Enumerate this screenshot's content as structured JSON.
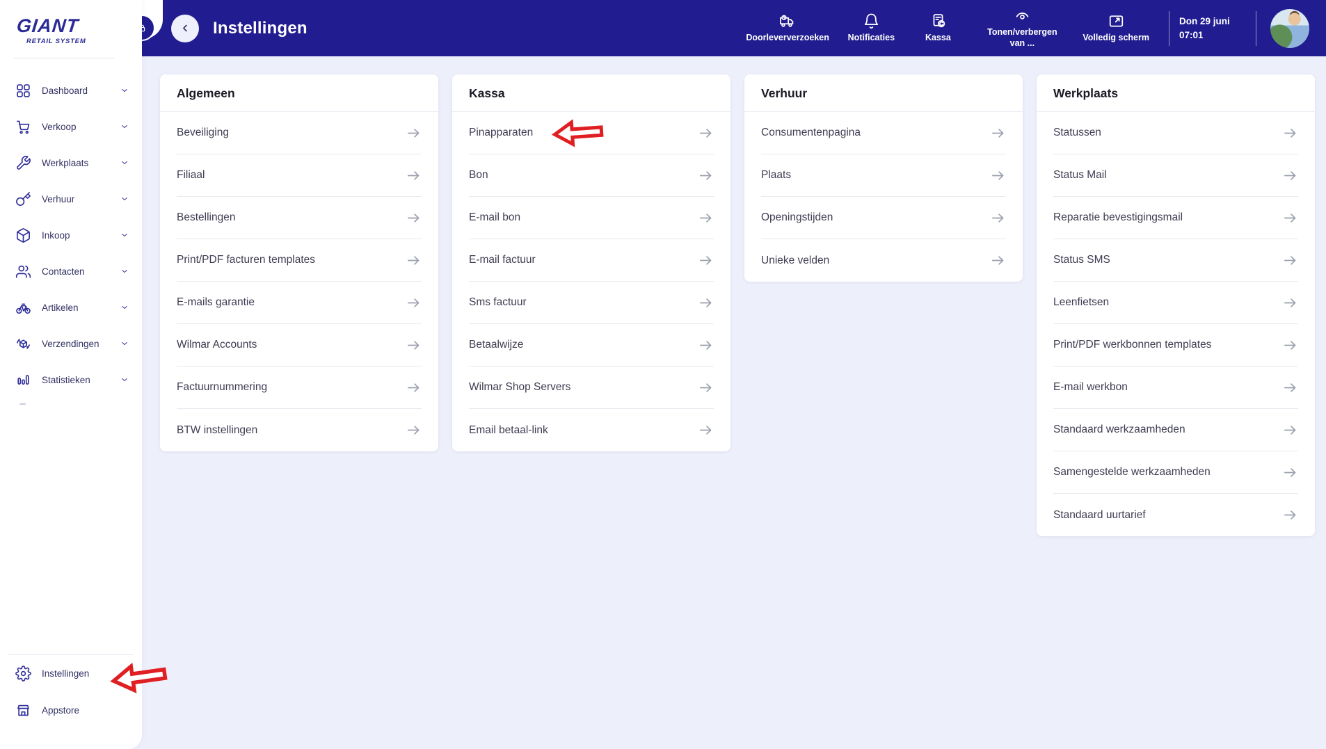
{
  "brand": {
    "name": "GIANT",
    "subtitle": "RETAIL SYSTEM"
  },
  "header": {
    "title": "Instellingen",
    "actions": [
      {
        "label": "Doorleververzoeken",
        "icon": "truck-icon"
      },
      {
        "label": "Notificaties",
        "icon": "bell-icon"
      },
      {
        "label": "Kassa",
        "icon": "cash-register-icon"
      },
      {
        "label": "Tonen/verbergen van ...",
        "icon": "eye-icon"
      },
      {
        "label": "Volledig scherm",
        "icon": "fullscreen-icon"
      }
    ],
    "datetime": {
      "date": "Don 29 juni",
      "time": "07:01"
    }
  },
  "sidebar": {
    "items": [
      {
        "label": "Dashboard",
        "icon": "grid-icon"
      },
      {
        "label": "Verkoop",
        "icon": "cart-icon"
      },
      {
        "label": "Werkplaats",
        "icon": "wrench-icon"
      },
      {
        "label": "Verhuur",
        "icon": "key-icon"
      },
      {
        "label": "Inkoop",
        "icon": "package-icon"
      },
      {
        "label": "Contacten",
        "icon": "people-icon"
      },
      {
        "label": "Artikelen",
        "icon": "bike-icon"
      },
      {
        "label": "Verzendingen",
        "icon": "shipping-icon"
      },
      {
        "label": "Statistieken",
        "icon": "stats-icon"
      }
    ],
    "bottom_items": [
      {
        "label": "Instellingen",
        "icon": "gear-icon"
      },
      {
        "label": "Appstore",
        "icon": "store-icon"
      }
    ]
  },
  "cards": [
    {
      "title": "Algemeen",
      "items": [
        "Beveiliging",
        "Filiaal",
        "Bestellingen",
        "Print/PDF facturen templates",
        "E-mails garantie",
        "Wilmar Accounts",
        "Factuurnummering",
        "BTW instellingen"
      ]
    },
    {
      "title": "Kassa",
      "items": [
        "Pinapparaten",
        "Bon",
        "E-mail bon",
        "E-mail factuur",
        "Sms factuur",
        "Betaalwijze",
        "Wilmar Shop Servers",
        "Email betaal-link"
      ]
    },
    {
      "title": "Verhuur",
      "items": [
        "Consumentenpagina",
        "Plaats",
        "Openingstijden",
        "Unieke velden"
      ]
    },
    {
      "title": "Werkplaats",
      "items": [
        "Statussen",
        "Status Mail",
        "Reparatie bevestigingsmail",
        "Status SMS",
        "Leenfietsen",
        "Print/PDF werkbonnen templates",
        "E-mail werkbon",
        "Standaard werkzaamheden",
        "Samengestelde werkzaamheden",
        "Standaard uurtarief"
      ]
    }
  ],
  "colors": {
    "header_bg": "#211c90",
    "accent": "#2e2d9a",
    "content_bg": "#edeffa",
    "annotation_red": "#e01f23"
  }
}
